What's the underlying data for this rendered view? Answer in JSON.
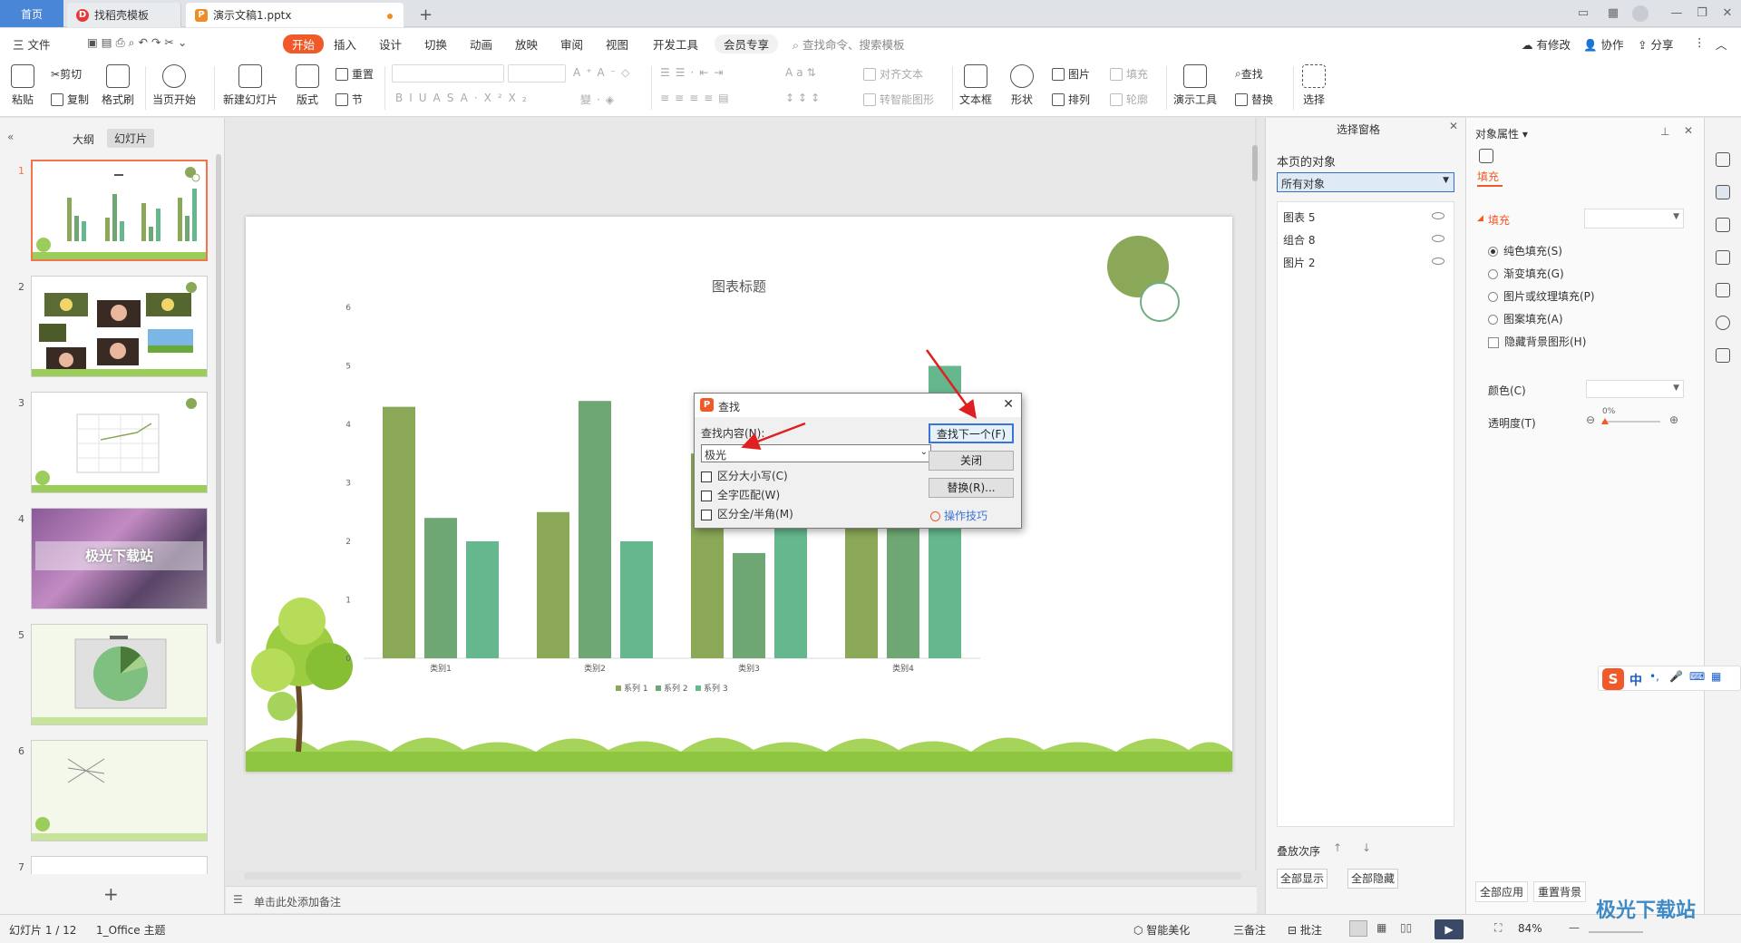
{
  "tabs": {
    "home": "首页",
    "template": "找稻壳模板",
    "document": "演示文稿1.pptx",
    "new_tab": "+"
  },
  "menu": {
    "file": "三 文件",
    "start": "开始",
    "insert": "插入",
    "design": "设计",
    "transition": "切换",
    "animation": "动画",
    "slideshow": "放映",
    "review": "审阅",
    "view": "视图",
    "developer": "开发工具",
    "vip": "会员专享",
    "search": "查找命令、搜索模板",
    "modified": "有修改",
    "collab": "协作",
    "share": "分享"
  },
  "ribbon": {
    "paste": "粘贴",
    "cut": "剪切",
    "copy": "复制",
    "format_painter": "格式刷",
    "play_from_current": "当页开始",
    "new_slide": "新建幻灯片",
    "layout": "版式",
    "reset": "重置",
    "section": "节",
    "align_text": "对齐文本",
    "smart_art": "转智能图形",
    "textbox": "文本框",
    "shape": "形状",
    "picture": "图片",
    "arrange": "排列",
    "fill": "填充",
    "outline": "轮廓",
    "present_tools": "演示工具",
    "find": "查找",
    "replace": "替换",
    "select": "选择"
  },
  "left_panel": {
    "outline_tab": "大纲",
    "slides_tab": "幻灯片",
    "slide_numbers": [
      "1",
      "2",
      "3",
      "4",
      "5",
      "6",
      "7"
    ],
    "slide4_text": "极光下载站",
    "add_slide": "+"
  },
  "notes_placeholder": "单击此处添加备注",
  "chart_data": {
    "type": "bar",
    "title": "图表标题",
    "categories": [
      "类别1",
      "类别2",
      "类别3",
      "类别4"
    ],
    "series": [
      {
        "name": "系列 1",
        "values": [
          4.3,
          2.5,
          3.5,
          4.5
        ],
        "color": "#8aa857"
      },
      {
        "name": "系列 2",
        "values": [
          2.4,
          4.4,
          1.8,
          2.8
        ],
        "color": "#6fa774"
      },
      {
        "name": "系列 3",
        "values": [
          2.0,
          2.0,
          3.0,
          5.0
        ],
        "color": "#65b88e"
      }
    ],
    "yticks": [
      "0",
      "1",
      "2",
      "3",
      "4",
      "5",
      "6"
    ],
    "ylim": [
      0,
      6
    ],
    "legend": "bottom"
  },
  "find_dialog": {
    "title": "查找",
    "find_label": "查找内容(N):",
    "find_value": "极光",
    "match_case": "区分大小写(C)",
    "whole_word": "全字匹配(W)",
    "width_match": "区分全/半角(M)",
    "find_next": "查找下一个(F)",
    "close": "关闭",
    "replace": "替换(R)...",
    "tips": "操作技巧"
  },
  "selection_pane": {
    "title": "选择窗格",
    "subtitle": "本页的对象",
    "filter": "所有对象",
    "objects": [
      "图表 5",
      "组合 8",
      "图片 2"
    ],
    "order_label": "叠放次序",
    "show_all": "全部显示",
    "hide_all": "全部隐藏"
  },
  "property_pane": {
    "title": "对象属性",
    "fill_tab": "填充",
    "fill_section": "填充",
    "options": [
      "纯色填充(S)",
      "渐变填充(G)",
      "图片或纹理填充(P)",
      "图案填充(A)"
    ],
    "hide_bg": "隐藏背景图形(H)",
    "color_label": "颜色(C)",
    "transparency_label": "透明度(T)",
    "transparency_value": "0%",
    "apply_all": "全部应用",
    "reset_bg": "重置背景"
  },
  "status": {
    "slide_count": "幻灯片 1 / 12",
    "theme": "1_Office 主题",
    "beautify": "智能美化",
    "notes": "三备注",
    "comments": "批注",
    "zoom": "84%"
  },
  "ime": {
    "lang": "中"
  },
  "watermark": "极光下载站"
}
